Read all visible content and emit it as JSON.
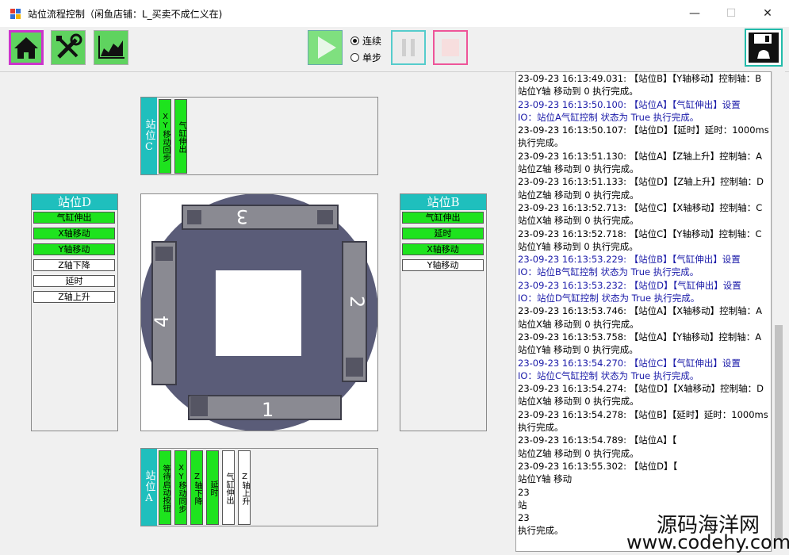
{
  "window": {
    "title": "站位流程控制（闲鱼店铺：L_买卖不成仁义在)",
    "minimize_glyph": "—",
    "maximize_glyph": "☐",
    "close_glyph": "✕"
  },
  "toolbar": {
    "home_icon": "home-icon",
    "tools_icon": "tools-icon",
    "chart_icon": "chart-icon",
    "play_icon": "play-icon",
    "pause_icon": "pause-icon",
    "stop_icon": "stop-icon",
    "save_icon": "save-icon",
    "mode_continuous": "连续",
    "mode_single": "单步",
    "selected_mode": "连续"
  },
  "station_c": {
    "title": "站位C",
    "steps": [
      {
        "label": "XY移动回步",
        "active": true
      },
      {
        "label": "气缸伸出",
        "active": true
      }
    ]
  },
  "station_d": {
    "title": "站位D",
    "steps": [
      {
        "label": "气缸伸出",
        "active": true
      },
      {
        "label": "X轴移动",
        "active": true
      },
      {
        "label": "Y轴移动",
        "active": true
      },
      {
        "label": "Z轴下降",
        "active": false
      },
      {
        "label": "延时",
        "active": false
      },
      {
        "label": "Z轴上升",
        "active": false
      }
    ]
  },
  "station_b": {
    "title": "站位B",
    "steps": [
      {
        "label": "气缸伸出",
        "active": true
      },
      {
        "label": "延时",
        "active": true
      },
      {
        "label": "X轴移动",
        "active": true
      },
      {
        "label": "Y轴移动",
        "active": false
      }
    ]
  },
  "station_a": {
    "title": "站位A",
    "steps": [
      {
        "label": "等待启动按钮",
        "active": true
      },
      {
        "label": "XY移动同步",
        "active": true
      },
      {
        "label": "Z轴下降",
        "active": true
      },
      {
        "label": "延时",
        "active": true
      },
      {
        "label": "气缸伸出",
        "active": false
      },
      {
        "label": "Z轴上升",
        "active": false
      }
    ]
  },
  "table_image": {
    "label_1": "1",
    "label_2": "2",
    "label_3": "3",
    "label_4": "4"
  },
  "log": {
    "lines": [
      {
        "text": "23-09-23 16:13:49.031: 【站位B】【Y轴移动】控制轴：B",
        "blue": false
      },
      {
        "text": "站位Y轴 移动到 0 执行完成。",
        "blue": false
      },
      {
        "text": "23-09-23 16:13:50.100: 【站位A】【气缸伸出】设置",
        "blue": true
      },
      {
        "text": "IO：站位A气缸控制 状态为 True 执行完成。",
        "blue": true
      },
      {
        "text": "23-09-23 16:13:50.107: 【站位D】【延时】延时：1000ms",
        "blue": false
      },
      {
        "text": "执行完成。",
        "blue": false
      },
      {
        "text": "23-09-23 16:13:51.130: 【站位A】【Z轴上升】控制轴：A",
        "blue": false
      },
      {
        "text": "站位Z轴 移动到 0 执行完成。",
        "blue": false
      },
      {
        "text": "23-09-23 16:13:51.133: 【站位D】【Z轴上升】控制轴：D",
        "blue": false
      },
      {
        "text": "站位Z轴 移动到 0 执行完成。",
        "blue": false
      },
      {
        "text": "23-09-23 16:13:52.713: 【站位C】【X轴移动】控制轴：C",
        "blue": false
      },
      {
        "text": "站位X轴 移动到 0 执行完成。",
        "blue": false
      },
      {
        "text": "23-09-23 16:13:52.718: 【站位C】【Y轴移动】控制轴：C",
        "blue": false
      },
      {
        "text": "站位Y轴 移动到 0 执行完成。",
        "blue": false
      },
      {
        "text": "23-09-23 16:13:53.229: 【站位B】【气缸伸出】设置",
        "blue": true
      },
      {
        "text": "IO：站位B气缸控制 状态为 True 执行完成。",
        "blue": true
      },
      {
        "text": "23-09-23 16:13:53.232: 【站位D】【气缸伸出】设置",
        "blue": true
      },
      {
        "text": "IO：站位D气缸控制 状态为 True 执行完成。",
        "blue": true
      },
      {
        "text": "23-09-23 16:13:53.746: 【站位A】【X轴移动】控制轴：A",
        "blue": false
      },
      {
        "text": "站位X轴 移动到 0 执行完成。",
        "blue": false
      },
      {
        "text": "23-09-23 16:13:53.758: 【站位A】【Y轴移动】控制轴：A",
        "blue": false
      },
      {
        "text": "站位Y轴 移动到 0 执行完成。",
        "blue": false
      },
      {
        "text": "23-09-23 16:13:54.270: 【站位C】【气缸伸出】设置",
        "blue": true
      },
      {
        "text": "IO：站位C气缸控制 状态为 True 执行完成。",
        "blue": true
      },
      {
        "text": "23-09-23 16:13:54.274: 【站位D】【X轴移动】控制轴：D",
        "blue": false
      },
      {
        "text": "站位X轴 移动到 0 执行完成。",
        "blue": false
      },
      {
        "text": "23-09-23 16:13:54.278: 【站位B】【延时】延时：1000ms",
        "blue": false
      },
      {
        "text": "执行完成。",
        "blue": false
      },
      {
        "text": "23-09-23 16:13:54.789: 【站位A】【",
        "blue": false
      },
      {
        "text": "站位Z轴 移动到 0 执行完成。",
        "blue": false
      },
      {
        "text": "23-09-23 16:13:55.302: 【站位D】【",
        "blue": false
      },
      {
        "text": "站位Y轴 移动",
        "blue": false
      },
      {
        "text": "23",
        "blue": false
      },
      {
        "text": "站",
        "blue": false
      },
      {
        "text": "23",
        "blue": false
      },
      {
        "text": "执行完成。",
        "blue": false
      }
    ]
  },
  "watermark": {
    "line1": "源码海洋网",
    "line2": "www.codehy.com"
  }
}
